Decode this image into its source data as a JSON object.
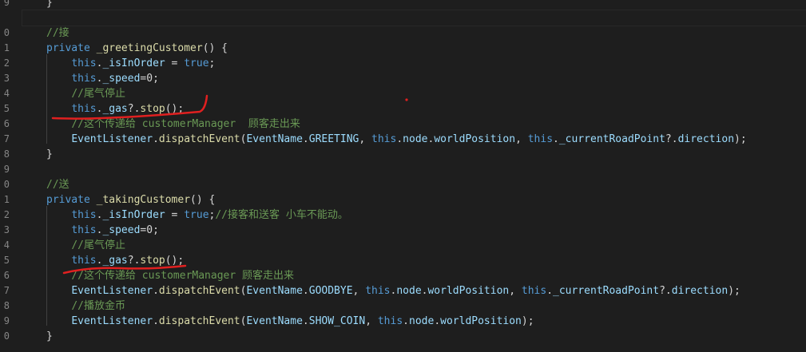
{
  "gutter": {
    "numbers": [
      "9",
      "",
      "0",
      "1",
      "2",
      "3",
      "4",
      "5",
      "6",
      "7",
      "8",
      "9",
      "0",
      "1",
      "2",
      "3",
      "4",
      "5",
      "6",
      "7",
      "8",
      "9",
      "0"
    ]
  },
  "code": {
    "lines": [
      [
        {
          "t": "}",
          "c": "p"
        }
      ],
      [],
      [
        {
          "t": "//接",
          "c": "c"
        }
      ],
      [
        {
          "t": "private ",
          "c": "k"
        },
        {
          "t": "_greetingCustomer",
          "c": "f"
        },
        {
          "t": "() {",
          "c": "p"
        }
      ],
      [
        {
          "t": "    ",
          "c": "p"
        },
        {
          "t": "this",
          "c": "k"
        },
        {
          "t": ".",
          "c": "p"
        },
        {
          "t": "_isInOrder",
          "c": "v"
        },
        {
          "t": " = ",
          "c": "p"
        },
        {
          "t": "true",
          "c": "k"
        },
        {
          "t": ";",
          "c": "p"
        }
      ],
      [
        {
          "t": "    ",
          "c": "p"
        },
        {
          "t": "this",
          "c": "k"
        },
        {
          "t": ".",
          "c": "p"
        },
        {
          "t": "_speed",
          "c": "v"
        },
        {
          "t": "=0;",
          "c": "p"
        }
      ],
      [
        {
          "t": "    ",
          "c": "p"
        },
        {
          "t": "//尾气停止",
          "c": "c"
        }
      ],
      [
        {
          "t": "    ",
          "c": "p"
        },
        {
          "t": "this",
          "c": "k"
        },
        {
          "t": ".",
          "c": "p"
        },
        {
          "t": "_gas",
          "c": "v"
        },
        {
          "t": "?.",
          "c": "p"
        },
        {
          "t": "stop",
          "c": "f"
        },
        {
          "t": "();",
          "c": "p"
        }
      ],
      [
        {
          "t": "    ",
          "c": "p"
        },
        {
          "t": "//这个传递给 customerManager  顾客走出来",
          "c": "c"
        }
      ],
      [
        {
          "t": "    ",
          "c": "p"
        },
        {
          "t": "EventListener",
          "c": "v"
        },
        {
          "t": ".",
          "c": "p"
        },
        {
          "t": "dispatchEvent",
          "c": "f"
        },
        {
          "t": "(",
          "c": "p"
        },
        {
          "t": "EventName",
          "c": "v"
        },
        {
          "t": ".",
          "c": "p"
        },
        {
          "t": "GREETING",
          "c": "v"
        },
        {
          "t": ", ",
          "c": "p"
        },
        {
          "t": "this",
          "c": "k"
        },
        {
          "t": ".",
          "c": "p"
        },
        {
          "t": "node",
          "c": "v"
        },
        {
          "t": ".",
          "c": "p"
        },
        {
          "t": "worldPosition",
          "c": "v"
        },
        {
          "t": ", ",
          "c": "p"
        },
        {
          "t": "this",
          "c": "k"
        },
        {
          "t": ".",
          "c": "p"
        },
        {
          "t": "_currentRoadPoint",
          "c": "v"
        },
        {
          "t": "?.",
          "c": "p"
        },
        {
          "t": "direction",
          "c": "v"
        },
        {
          "t": ");",
          "c": "p"
        }
      ],
      [
        {
          "t": "}",
          "c": "p"
        }
      ],
      [],
      [
        {
          "t": "//送",
          "c": "c"
        }
      ],
      [
        {
          "t": "private ",
          "c": "k"
        },
        {
          "t": "_takingCustomer",
          "c": "f"
        },
        {
          "t": "() {",
          "c": "p"
        }
      ],
      [
        {
          "t": "    ",
          "c": "p"
        },
        {
          "t": "this",
          "c": "k"
        },
        {
          "t": ".",
          "c": "p"
        },
        {
          "t": "_isInOrder",
          "c": "v"
        },
        {
          "t": " = ",
          "c": "p"
        },
        {
          "t": "true",
          "c": "k"
        },
        {
          "t": ";",
          "c": "p"
        },
        {
          "t": "//接客和送客 小车不能动。",
          "c": "c"
        }
      ],
      [
        {
          "t": "    ",
          "c": "p"
        },
        {
          "t": "this",
          "c": "k"
        },
        {
          "t": ".",
          "c": "p"
        },
        {
          "t": "_speed",
          "c": "v"
        },
        {
          "t": "=0;",
          "c": "p"
        }
      ],
      [
        {
          "t": "    ",
          "c": "p"
        },
        {
          "t": "//尾气停止",
          "c": "c"
        }
      ],
      [
        {
          "t": "    ",
          "c": "p"
        },
        {
          "t": "this",
          "c": "k"
        },
        {
          "t": ".",
          "c": "p"
        },
        {
          "t": "_gas",
          "c": "v"
        },
        {
          "t": "?.",
          "c": "p"
        },
        {
          "t": "stop",
          "c": "f"
        },
        {
          "t": "();",
          "c": "p"
        }
      ],
      [
        {
          "t": "    ",
          "c": "p"
        },
        {
          "t": "//这个传递给 customerManager 顾客走出来",
          "c": "c"
        }
      ],
      [
        {
          "t": "    ",
          "c": "p"
        },
        {
          "t": "EventListener",
          "c": "v"
        },
        {
          "t": ".",
          "c": "p"
        },
        {
          "t": "dispatchEvent",
          "c": "f"
        },
        {
          "t": "(",
          "c": "p"
        },
        {
          "t": "EventName",
          "c": "v"
        },
        {
          "t": ".",
          "c": "p"
        },
        {
          "t": "GOODBYE",
          "c": "v"
        },
        {
          "t": ", ",
          "c": "p"
        },
        {
          "t": "this",
          "c": "k"
        },
        {
          "t": ".",
          "c": "p"
        },
        {
          "t": "node",
          "c": "v"
        },
        {
          "t": ".",
          "c": "p"
        },
        {
          "t": "worldPosition",
          "c": "v"
        },
        {
          "t": ", ",
          "c": "p"
        },
        {
          "t": "this",
          "c": "k"
        },
        {
          "t": ".",
          "c": "p"
        },
        {
          "t": "_currentRoadPoint",
          "c": "v"
        },
        {
          "t": "?.",
          "c": "p"
        },
        {
          "t": "direction",
          "c": "v"
        },
        {
          "t": ");",
          "c": "p"
        }
      ],
      [
        {
          "t": "    ",
          "c": "p"
        },
        {
          "t": "//播放金币",
          "c": "c"
        }
      ],
      [
        {
          "t": "    ",
          "c": "p"
        },
        {
          "t": "EventListener",
          "c": "v"
        },
        {
          "t": ".",
          "c": "p"
        },
        {
          "t": "dispatchEvent",
          "c": "f"
        },
        {
          "t": "(",
          "c": "p"
        },
        {
          "t": "EventName",
          "c": "v"
        },
        {
          "t": ".",
          "c": "p"
        },
        {
          "t": "SHOW_COIN",
          "c": "v"
        },
        {
          "t": ", ",
          "c": "p"
        },
        {
          "t": "this",
          "c": "k"
        },
        {
          "t": ".",
          "c": "p"
        },
        {
          "t": "node",
          "c": "v"
        },
        {
          "t": ".",
          "c": "p"
        },
        {
          "t": "worldPosition",
          "c": "v"
        },
        {
          "t": ");",
          "c": "p"
        }
      ],
      [
        {
          "t": "}",
          "c": "p"
        }
      ]
    ]
  },
  "colors": {
    "background": "#1e1e1e",
    "keyword": "#569cd6",
    "function": "#dcdcaa",
    "variable": "#9cdcfe",
    "comment": "#6a9955",
    "punctuation": "#d4d4d4",
    "line_number": "#858585",
    "annotation_ink": "#e02020"
  },
  "annotations": [
    "red-underline-first-gas-stop",
    "red-underline-second-gas-stop",
    "red-dot"
  ]
}
